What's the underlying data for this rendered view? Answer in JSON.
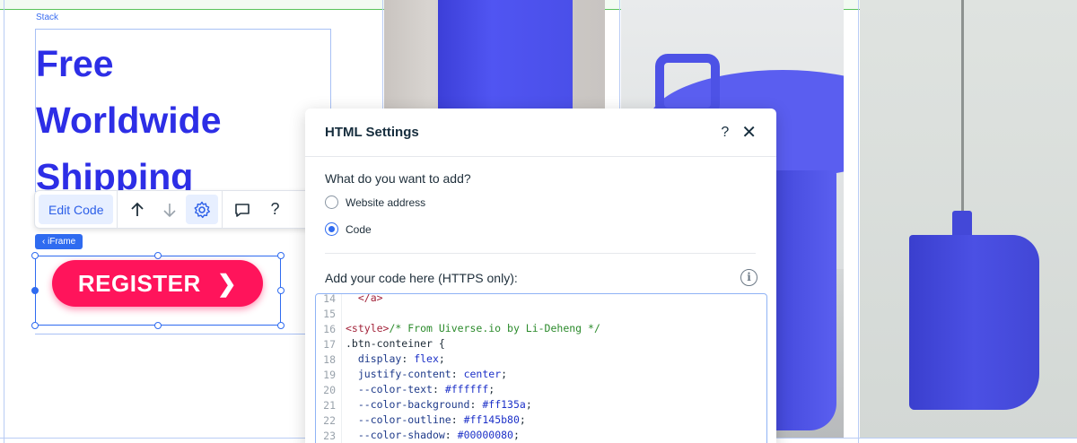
{
  "stack_label": "Stack",
  "headline": [
    "Free",
    "Worldwide",
    "Shipping"
  ],
  "toolbar": {
    "edit_code_label": "Edit Code",
    "help_label": "?"
  },
  "iframe_tag": "‹ iFrame",
  "register_button": {
    "label": "REGISTER",
    "arrow": "❯"
  },
  "settings": {
    "title": "HTML Settings",
    "help_label": "?",
    "close_label": "✕",
    "question": "What do you want to add?",
    "options": [
      {
        "label": "Website address",
        "checked": false
      },
      {
        "label": "Code",
        "checked": true
      }
    ],
    "code_label": "Add your code here (HTTPS only):",
    "info_label": "i"
  },
  "code_lines": [
    {
      "num": "14",
      "text": "  </a>"
    },
    {
      "num": "15",
      "text": ""
    },
    {
      "num": "16",
      "text": "<style>/* From Uiverse.io by Li-Deheng */"
    },
    {
      "num": "17",
      "text": ".btn-conteiner {"
    },
    {
      "num": "18",
      "text": "  display: flex;"
    },
    {
      "num": "19",
      "text": "  justify-content: center;"
    },
    {
      "num": "20",
      "text": "  --color-text: #ffffff;"
    },
    {
      "num": "21",
      "text": "  --color-background: #ff135a;"
    },
    {
      "num": "22",
      "text": "  --color-outline: #ff145b80;"
    },
    {
      "num": "23",
      "text": "  --color-shadow: #00000080;"
    }
  ],
  "colors": {
    "headline": "#2d2ee6",
    "register": "#ff145b",
    "accent": "#2f6bf0",
    "product_blue": "#4a4fe9"
  }
}
